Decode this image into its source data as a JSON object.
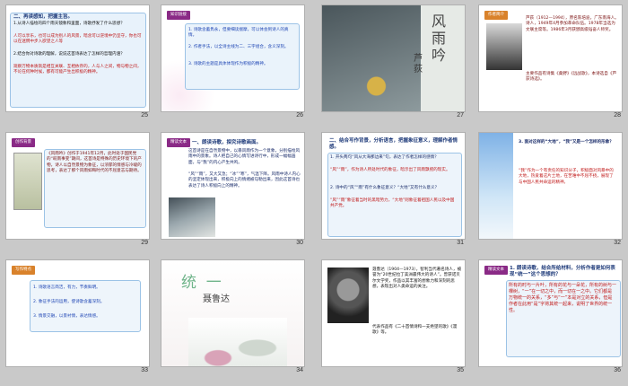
{
  "slides": [
    {
      "num": "25",
      "heading": "二、再读感知，把握主旨。",
      "q1": "1.从诗人描绘的四个雨天镜象和里面，诗歌抒发了什么思想？",
      "a1": "人可以享乐，也可以成为别人的风景，暗含可以逆境中仍坚守，你也可以在迷惘中步入欲望之人等",
      "q2": "2.结合你对诗歌的理解，说说这首诗表达了怎样的哲理内涵？",
      "a2": "观察万物本质就是相互关联、互相依存的，人与人之间，物与物之间，不论在何种时候，都有可能产生出积极的精神。"
    },
    {
      "num": "26",
      "tag": "知识链接",
      "items": [
        "1. 诗歌含蓄隽永，但要细读揣摩，可以体会到诗人的真情。",
        "2. 作者手法，以全诗主线为二、三字组合，含义深刻。",
        "3. 诗歌的主题是具体体现作为积极的精神。"
      ]
    },
    {
      "num": "27",
      "title": "风雨吟",
      "author": "芦荻"
    },
    {
      "num": "28",
      "tag": "作者简介",
      "bio": "芦荻（1912—1994），原名陈培迪，广东南海人。诗人，1949年4月参加革命队伍。1978年当选为文联主席等。1986年3月获颁高级韬奋人师奖。",
      "works": "主要作品有诗集《桑野》《远战歌》，本诗选自《芦荻诗选》。"
    },
    {
      "num": "29",
      "tag": "创作背景",
      "text": "《风雨吟》创作于1941年12月，此时处于国民党的“皖南事变”期间，这首诗是特殊的历史环境下的产物，诗人以自然景物为象征，以浓郁的情感与冷峻的思考，表达了那个风雨如晦时代的不屈意志与期待。"
    },
    {
      "num": "30",
      "tag": "精读文本",
      "heading": "一、朗读诗歌，探究诗歌画面。",
      "p1": "这首诗是在自然景物中，以暴风雨作为一个意象，分别描绘风雨中的景象。诗人把自己的心情写进诗行中，形成一幅幅画面，与“我”的内心产生共鸣。",
      "p2": "“风”“雨”，又大又急；“冰”“寒”，气温下降。风雨中诗人内心的坚定体现出来，积极向上的情绪被勾勒出来，因此这首诗也表达了诗人积极向上的精神。"
    },
    {
      "num": "31",
      "heading": "二、结合写作背景，分析语言，把握象征意义，理解作者情感。",
      "q1": "1. 开头两句“风从大海那边来”句，表达了作者怎样的感情？",
      "a1": "“风”“雨”，作为诗人所处时代的象征，暗示出了风雨飘摇的现实。",
      "q2": "2. 诗中的“风”“雨”有什么象征意义？“大地”又有什么意义？",
      "a2": "“风”“雨”象征着当时的黑暗势力，“大地”则象征着祖国人民以及中国共产党。"
    },
    {
      "num": "32",
      "q": "3. 面对这样的“大地”，“我”又是一个怎样的形象？",
      "a": "“我”作为一个有责任的知识分子，积极面对风暴中的大地，热爱着这片土地，在苦难中不屈不挠，展现了与中国人民共命运的精神。"
    },
    {
      "num": "33",
      "tag": "写作特点",
      "items": [
        "1. 诗歌语言简洁，有力，节奏鲜明。",
        "2. 象征手法的运用，使诗歌含蓄深刻。",
        "3. 情景交融，以景衬情，表达情感。"
      ]
    },
    {
      "num": "34",
      "title": "统  一",
      "author": "聂鲁达"
    },
    {
      "num": "35",
      "bio": "聂鲁达（1904—1973），智利当代著名诗人，被誉为“20世纪拉丁美洲最伟大的诗人”。曾获诺贝尔文学奖，作品以其丰富的想象力和深刻的思想，表现出对人类命运的关注。",
      "works": "代表作品有《二十首情诗和一支绝望的歌》《漫歌》等。"
    },
    {
      "num": "36",
      "tag": "精读文本",
      "heading": "1. 朗读诗歌，结合所给材料，分析作者是如何表现“统一”这个思想的？",
      "quote": "所有的时与一片叶，所有的花与一朵花，所有的树与一棵树，“一”在一切之中，而一切在一之中。它们都是万物统一的关系，“多”与“一”本是对立的关系，但是作者在此用“是”字将其统一起来，说明了世界的统一性。"
    }
  ]
}
